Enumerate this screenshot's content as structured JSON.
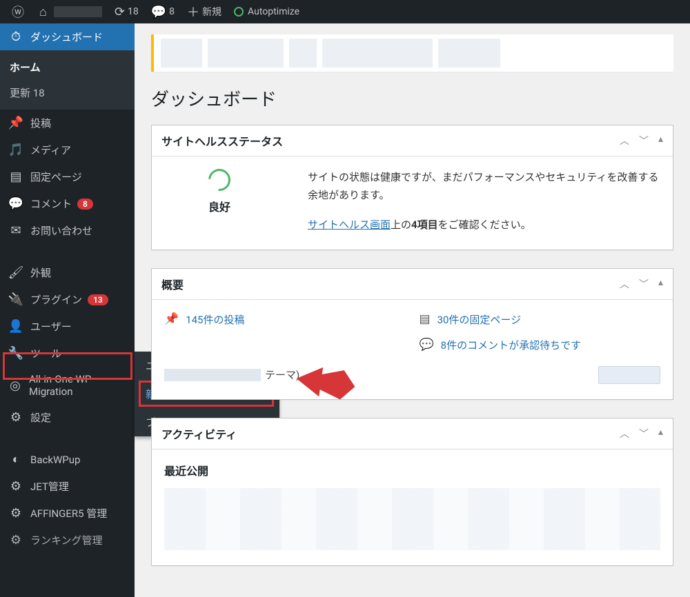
{
  "adminbar": {
    "updates_count": "18",
    "comments_count": "8",
    "new_label": "新規",
    "autoptimize": "Autoptimize"
  },
  "sidebar": {
    "dashboard": "ダッシュボード",
    "home": "ホーム",
    "updates": "更新",
    "updates_badge": "18",
    "posts": "投稿",
    "media": "メディア",
    "pages": "固定ページ",
    "comments": "コメント",
    "comments_badge": "8",
    "contact": "お問い合わせ",
    "appearance": "外観",
    "plugins": "プラグイン",
    "plugins_badge": "13",
    "users": "ユーザー",
    "tools": "ツール",
    "aio_migration": "All-in-One WP Migration",
    "settings": "設定",
    "backwpup": "BackWPup",
    "jet": "JET管理",
    "affinger": "AFFINGER5 管理",
    "ranking": "ランキング管理"
  },
  "flyout": {
    "users_list": "ユーザー一覧",
    "add_new": "新規追加",
    "profile": "プロフィール"
  },
  "page": {
    "title": "ダッシュボード"
  },
  "health": {
    "panel_title": "サイトヘルスステータス",
    "status_label": "良好",
    "desc": "サイトの状態は健康ですが、まだパフォーマンスやセキュリティを改善する余地があります。",
    "link_text": "サイトヘルス画面",
    "desc2_before": "上の",
    "desc2_bold": "4項目",
    "desc2_after": "をご確認ください。"
  },
  "overview": {
    "panel_title": "概要",
    "posts": "145件の投稿",
    "pages": "30件の固定ページ",
    "comments_pending": "8件のコメントが承認待ちです",
    "theme_suffix": "テーマ)"
  },
  "activity": {
    "panel_title": "アクティビティ",
    "recent_label": "最近公開"
  }
}
